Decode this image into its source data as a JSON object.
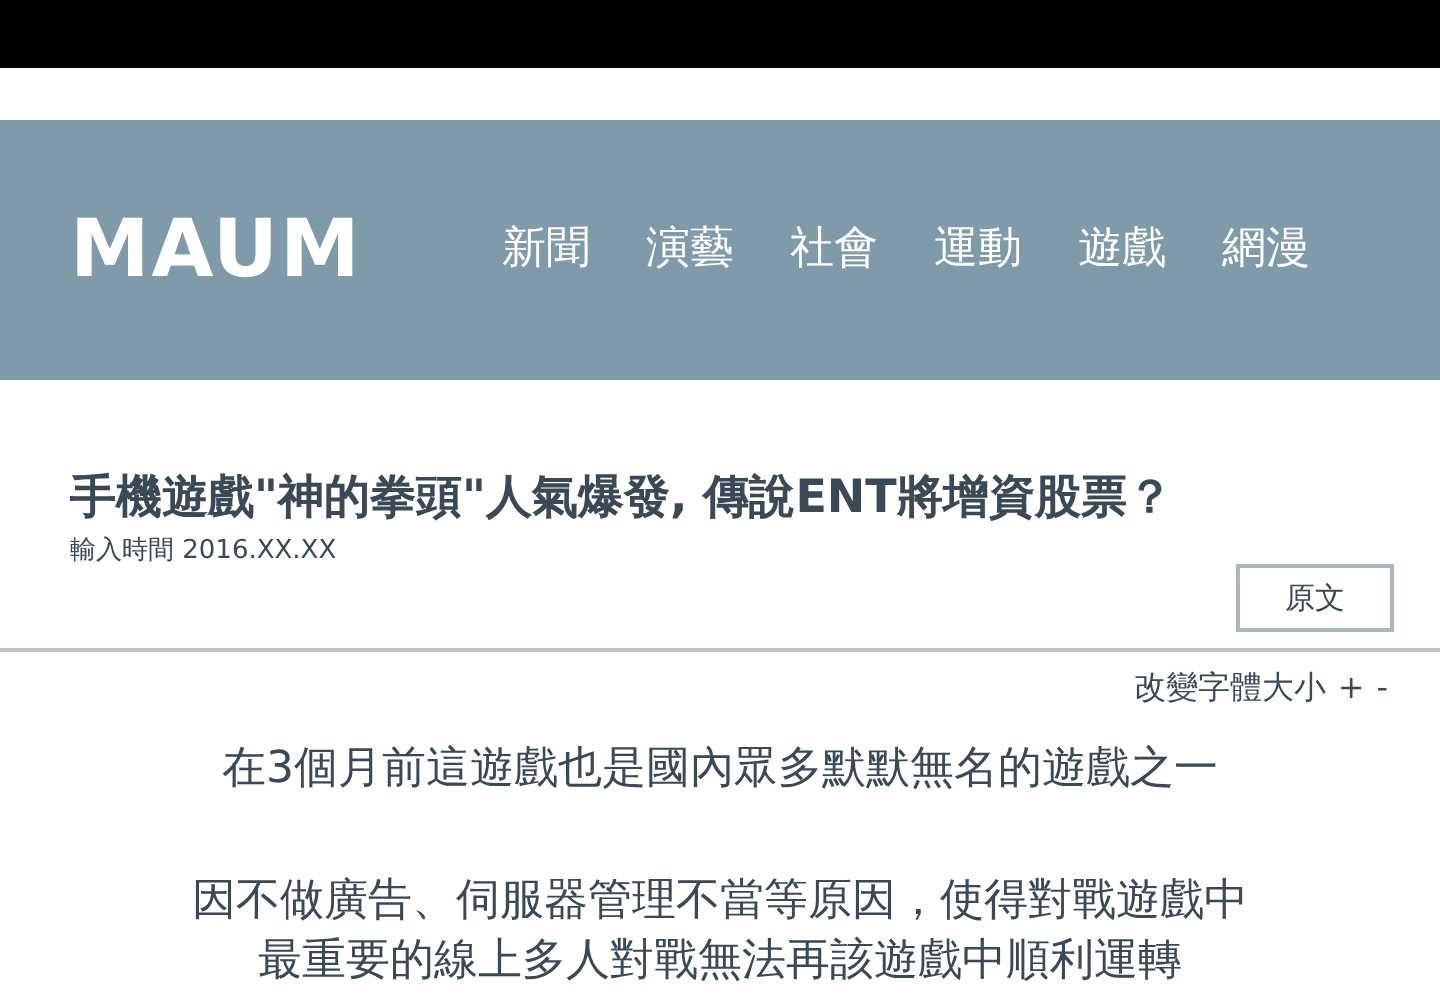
{
  "site": {
    "logo": "MAUM",
    "nav": [
      {
        "label": "新聞"
      },
      {
        "label": "演藝"
      },
      {
        "label": "社會"
      },
      {
        "label": "運動"
      },
      {
        "label": "遊戲"
      },
      {
        "label": "網漫"
      }
    ]
  },
  "article": {
    "title": "手機遊戲\"神的拳頭\"人氣爆發, 傳說ENT將增資股票？",
    "meta": "輸入時間 2016.XX.XX",
    "source_button": "原文",
    "font_size": {
      "label": "改變字體大小",
      "increase": "+",
      "decrease": "-"
    },
    "paragraphs": [
      {
        "lines": [
          "在3個月前這遊戲也是國內眾多默默無名的遊戲之一"
        ]
      },
      {
        "lines": [
          "因不做廣告、伺服器管理不當等原因，使得對戰遊戲中",
          "最重要的線上多人對戰無法再該遊戲中順利運轉"
        ]
      }
    ]
  }
}
